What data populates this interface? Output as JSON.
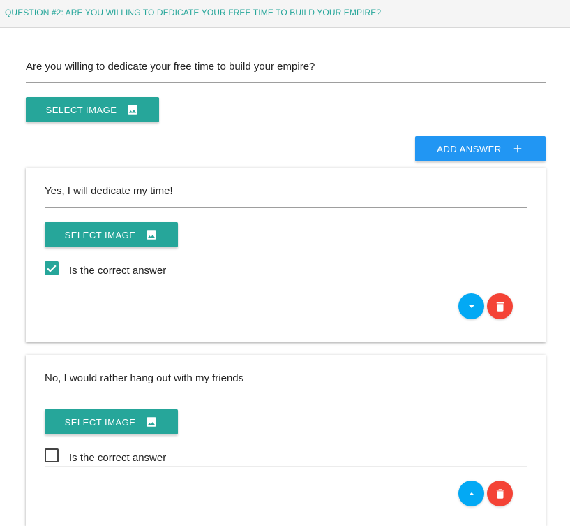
{
  "header": {
    "title": "QUESTION #2: ARE YOU WILLING TO DEDICATE YOUR FREE TIME TO BUILD YOUR EMPIRE?"
  },
  "question": {
    "text": "Are you willing to dedicate your free time to build your empire?",
    "select_image_label": "SELECT IMAGE"
  },
  "add_answer_label": "ADD ANSWER",
  "answers": [
    {
      "text": "Yes, I will dedicate my time!",
      "select_image_label": "SELECT IMAGE",
      "correct_label": "Is the correct answer",
      "is_correct": true,
      "move_icon": "chevron-down-icon"
    },
    {
      "text": "No, I would rather hang out with my friends",
      "select_image_label": "SELECT IMAGE",
      "correct_label": "Is the correct answer",
      "is_correct": false,
      "move_icon": "chevron-up-icon"
    }
  ],
  "colors": {
    "teal": "#26a69a",
    "blue": "#2196f3",
    "light_blue": "#03a9f4",
    "red": "#f44336"
  }
}
